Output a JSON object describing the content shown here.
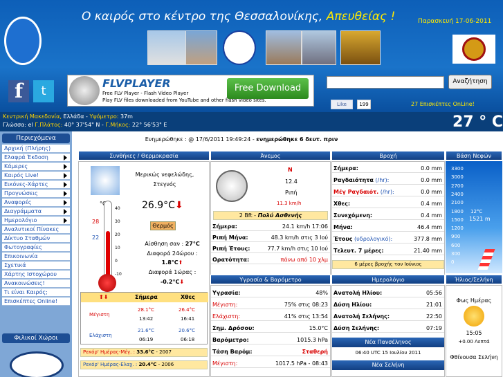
{
  "header": {
    "title_main": "Ο καιρός στο κέντρο της Θεσσαλονίκης, ",
    "title_live": "Απευθείας !",
    "date": "Παρασκευή 17-06-2011"
  },
  "social": {
    "fb": "f",
    "tw": "t"
  },
  "flv": {
    "title": "FLVPLAYER",
    "line1": "Free FLV Player - Flash Video Player",
    "line2": "Play FLV files downloaded from YouTube and other flash video sites.",
    "button": "Free Download"
  },
  "search": {
    "button": "Αναζήτηση",
    "placeholder": ""
  },
  "like": {
    "label": "Like",
    "count": "199"
  },
  "online": "27 Επισκέπτες OnLine!",
  "info": {
    "region": "Κεντρική Μακεδονία,",
    "country": " Ελλάδα - ",
    "alt_label": "Υψόμετρο:",
    "alt": " 37m",
    "lang": "Γλώσσα: el",
    "lat_label": " Γ.Πλάτος:",
    "lat": " 40° 37'54\" N - ",
    "lon_label": "Γ.Μήκος:",
    "lon": " 22° 56'53\" E",
    "temp": "27 ° C"
  },
  "sidebar": {
    "head1": "Περιεχόμενα",
    "items": [
      "Αρχική (Πλήρης)",
      "Ελαφρά Έκδοση",
      "Κάμερες",
      "Καιρός Live!",
      "Εικόνες-Χάρτες",
      "Προγνώσεις",
      "Αναφορές",
      "Διαγράμματα",
      "Ημερολόγιο",
      "Αναλυτικοί Πίνακες",
      "Δίκτυο Σταθμών",
      "Φωτογραφίες",
      "Επικοινωνία",
      "Σχετικά",
      "Χάρτης Ιστοχώρου",
      "Ανακοινώσεις!",
      "Τι είναι Καιρός;",
      "Επισκέπτες Online!"
    ],
    "head2": "Φιλικοί Χώροι"
  },
  "updated": {
    "text": "Ενημερώθηκε : @ 17/6/2011 19:49:24 - ",
    "bold": "ενημερώθηκε 6 δευτ. πριν"
  },
  "cols": {
    "cond": "Συνθήκες / Θερμοκρασία",
    "wind": "Άνεμος",
    "rain": "Βροχή",
    "cloud": "Βάση Νεφών",
    "humid": "Υγρασία & Βαρόμετρο",
    "cal": "Ημερολόγιο",
    "sun": "Ήλιος/Σελήνη"
  },
  "cond": {
    "desc1": "Μερικώς νεφελώδης,",
    "desc2": "Στεγνός",
    "temp": "26.9°C",
    "button": "Θερμός",
    "feels_label": "Αίσθηση σαν : ",
    "feels": "27°C",
    "diff24_label": "Διαφορά 24ώρου :",
    "diff24": "1.8°C",
    "diff1_label": "Διαφορά 1ώρας :",
    "diff1": "-0.2°C",
    "scale_top": "°C",
    "red_mark": "28",
    "blue_mark": "22",
    "ticks": [
      "40",
      "30",
      "20",
      "10",
      "0",
      "-10"
    ]
  },
  "minmax": {
    "h_today": "Σήμερα",
    "h_yday": "Χθες",
    "max_label": "Μέγιστη",
    "max_today": "28.1°C",
    "max_today_t": "13:42",
    "max_yday": "26.4°C",
    "max_yday_t": "16:41",
    "min_label": "Ελάχιστη",
    "min_today": "21.6°C",
    "min_today_t": "06:19",
    "min_yday": "20.6°C",
    "min_yday_t": "06:18",
    "rec_max_label": "Ρεκόρ' Ημέρας-Μέγ. : ",
    "rec_max": "33.6°C",
    "rec_max_y": " - 2007",
    "rec_min_label": "Ρεκόρ' Ημέρας-Ελαχ. : ",
    "rec_min": "20.4°C",
    "rec_min_y": " - 2006"
  },
  "wind": {
    "dir": "Ν",
    "speed": "12.4",
    "gust_label": "Ριπή",
    "gust": "11.3 km/h",
    "bft": "2 Bft - ",
    "bft_text": "Πολύ Ασθενής",
    "rows": [
      {
        "l": "Σήμερα:",
        "v": "24.1 km/h 17:06"
      },
      {
        "l": "Ριπή Μήνα:",
        "v": "48.3 km/h στις 3 Ιού"
      },
      {
        "l": "Ριπή Έτους:",
        "v": "77.7 km/h στις 10 Ιού"
      },
      {
        "l": "Ορατότητα:",
        "v": "πάνω από 10 χλμ"
      }
    ]
  },
  "rain": {
    "rows": [
      {
        "l": "Σήμερα:",
        "v": "0.0 mm"
      },
      {
        "l": "Ραγδαιότητα",
        "u": " (/hr):",
        "v": "0.0 mm"
      },
      {
        "l": "Μέγ Ραγδαιότ.",
        "u": " (/hr):",
        "v": "0.0 mm"
      },
      {
        "l": "Χθες:",
        "v": "0.4 mm"
      },
      {
        "l": "Συνεχόμενη:",
        "v": "0.4 mm"
      },
      {
        "l": "Μήνα:",
        "v": "46.4 mm"
      },
      {
        "l": "Έτους",
        "u": " (υδρολογικό):",
        "v": "377.8 mm"
      },
      {
        "l": "Τελευτ. 7 μέρες:",
        "v": "21.40 mm"
      }
    ],
    "note": "6 μέρες βροχής τον Ιούνιος"
  },
  "cloud": {
    "scale": [
      "3300",
      "3000",
      "2700",
      "2400",
      "2100",
      "1800",
      "1500",
      "1200",
      "900",
      "600",
      "300",
      "0"
    ],
    "temp": "12°C",
    "height": "1521 m"
  },
  "humid": {
    "rows": [
      {
        "l": "Υγρασία:",
        "v": "48%"
      },
      {
        "l": "Μέγιστη:",
        "v": "75% στις 08:23"
      },
      {
        "l": "Ελάχιστη:",
        "v": "41% στις 13:54"
      },
      {
        "l": "Σημ. Δρόσου:",
        "v": "15.0°C"
      },
      {
        "l": "Βαρόμετρο:",
        "v": "1015.3 hPa"
      },
      {
        "l": "Τάση Βαρόμ:",
        "v": "Σταθερή"
      },
      {
        "l": "Μέγιστη:",
        "v": "1017.5 hPa - 08:43"
      }
    ]
  },
  "cal": {
    "rows": [
      {
        "l": "Ανατολή Ηλίου:",
        "v": "05:56"
      },
      {
        "l": "Δύση Ηλίου:",
        "v": "21:01"
      },
      {
        "l": "Ανατολή Σελήνης:",
        "v": "22:50"
      },
      {
        "l": "Δύση Σελήνης:",
        "v": "07:19"
      }
    ],
    "full_moon": "Νέα Πανσέληνος",
    "full_moon_date": "06:40 UTC 15 Ιουλίου 2011",
    "new_moon": "Νέα Σελήνη"
  },
  "sun": {
    "label": "Φως Ημέρας",
    "time": "15:05",
    "delta": "+0.00 Λεπτά",
    "moon": "Φθίνουσα Σελήνη"
  }
}
